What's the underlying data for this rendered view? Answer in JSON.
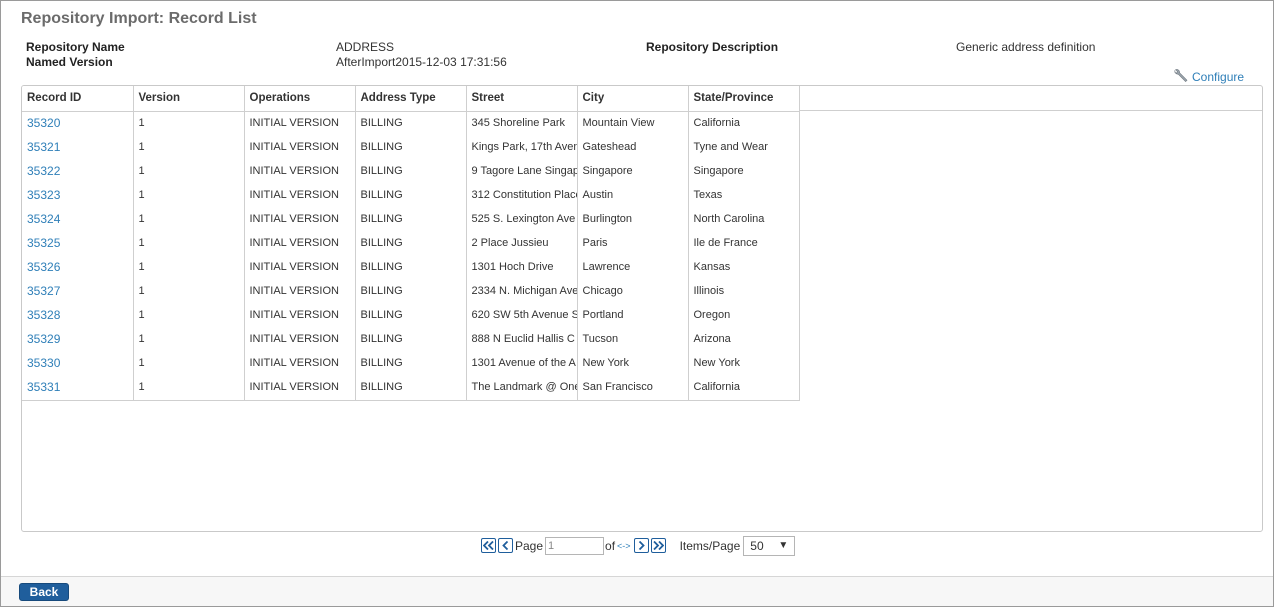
{
  "page": {
    "title": "Repository Import: Record List"
  },
  "meta": {
    "repo_name_label": "Repository Name",
    "repo_name_value": "ADDRESS",
    "named_version_label": "Named Version",
    "named_version_value": "AfterImport2015-12-03 17:31:56",
    "repo_desc_label": "Repository Description",
    "repo_desc_value": "Generic address definition"
  },
  "toolbar": {
    "configure_label": "Configure",
    "configure_icon": "wrench-icon"
  },
  "table": {
    "columns": [
      "Record ID",
      "Version",
      "Operations",
      "Address Type",
      "Street",
      "City",
      "State/Province"
    ],
    "rows": [
      [
        "35320",
        "1",
        "INITIAL VERSION",
        "BILLING",
        "345 Shoreline Park",
        "Mountain View",
        "California"
      ],
      [
        "35321",
        "1",
        "INITIAL VERSION",
        "BILLING",
        "Kings Park, 17th Aven",
        "Gateshead",
        "Tyne and Wear"
      ],
      [
        "35322",
        "1",
        "INITIAL VERSION",
        "BILLING",
        "9 Tagore Lane Singap",
        "Singapore",
        "Singapore"
      ],
      [
        "35323",
        "1",
        "INITIAL VERSION",
        "BILLING",
        "312 Constitution Place",
        "Austin",
        "Texas"
      ],
      [
        "35324",
        "1",
        "INITIAL VERSION",
        "BILLING",
        "525 S. Lexington Ave",
        "Burlington",
        "North Carolina"
      ],
      [
        "35325",
        "1",
        "INITIAL VERSION",
        "BILLING",
        "2 Place Jussieu",
        "Paris",
        "Ile de France"
      ],
      [
        "35326",
        "1",
        "INITIAL VERSION",
        "BILLING",
        "1301 Hoch Drive",
        "Lawrence",
        "Kansas"
      ],
      [
        "35327",
        "1",
        "INITIAL VERSION",
        "BILLING",
        "2334 N. Michigan Ave",
        "Chicago",
        "Illinois"
      ],
      [
        "35328",
        "1",
        "INITIAL VERSION",
        "BILLING",
        "620 SW 5th Avenue S",
        "Portland",
        "Oregon"
      ],
      [
        "35329",
        "1",
        "INITIAL VERSION",
        "BILLING",
        "888 N Euclid  Hallis C",
        "Tucson",
        "Arizona"
      ],
      [
        "35330",
        "1",
        "INITIAL VERSION",
        "BILLING",
        "1301 Avenue of the A",
        "New York",
        "New York"
      ],
      [
        "35331",
        "1",
        "INITIAL VERSION",
        "BILLING",
        "The Landmark @ One",
        "San Francisco",
        "California"
      ]
    ]
  },
  "pager": {
    "page_label": "Page",
    "page_value": "1",
    "of_label": "of",
    "total_placeholder": "<->",
    "items_per_page_label": "Items/Page",
    "items_per_page_value": "50"
  },
  "footer": {
    "back_label": "Back"
  },
  "colors": {
    "link": "#2f7fb8",
    "primary_button": "#1f5e9c",
    "title": "#6b6b6b"
  }
}
